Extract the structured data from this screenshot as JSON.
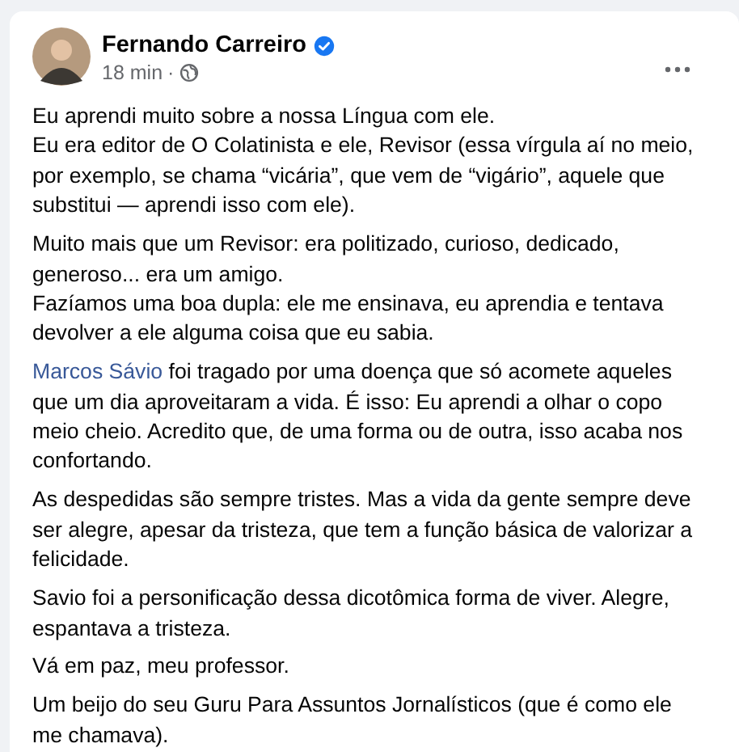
{
  "post": {
    "author": "Fernando Carreiro",
    "verified": true,
    "time": "18 min",
    "separator": "·",
    "paragraphs": [
      {
        "lines": [
          {
            "text": "Eu aprendi muito sobre a nossa Língua com ele."
          },
          {
            "text": "Eu era editor de O Colatinista e ele, Revisor (essa vírgula aí no meio, por exemplo, se chama “vicária”, que vem de “vigário”, aquele que substitui — aprendi isso com ele)."
          }
        ]
      },
      {
        "lines": [
          {
            "text": "Muito mais que um Revisor: era politizado, curioso, dedicado, generoso... era um amigo."
          },
          {
            "text": "Fazíamos uma boa dupla: ele me ensinava, eu aprendia e tentava devolver a ele alguma coisa que eu sabia."
          }
        ]
      },
      {
        "lines": [
          {
            "link": "Marcos Sávio",
            "text": " foi tragado por uma doença que só acomete aqueles que um dia aproveitaram a vida. É isso: Eu aprendi a olhar o copo meio cheio. Acredito que, de uma forma ou de outra, isso acaba nos confortando."
          }
        ]
      },
      {
        "lines": [
          {
            "text": "As despedidas são sempre tristes. Mas a vida da gente sempre deve ser alegre, apesar da tristeza, que tem a função básica de valorizar a felicidade."
          }
        ]
      },
      {
        "lines": [
          {
            "text": "Savio foi a personificação dessa dicotômica forma de viver. Alegre, espantava a tristeza."
          }
        ]
      },
      {
        "lines": [
          {
            "text": "Vá em paz, meu professor."
          }
        ]
      },
      {
        "lines": [
          {
            "text": "Um beijo do seu Guru Para Assuntos Jornalísticos (que é como ele me chamava)."
          }
        ]
      }
    ]
  }
}
